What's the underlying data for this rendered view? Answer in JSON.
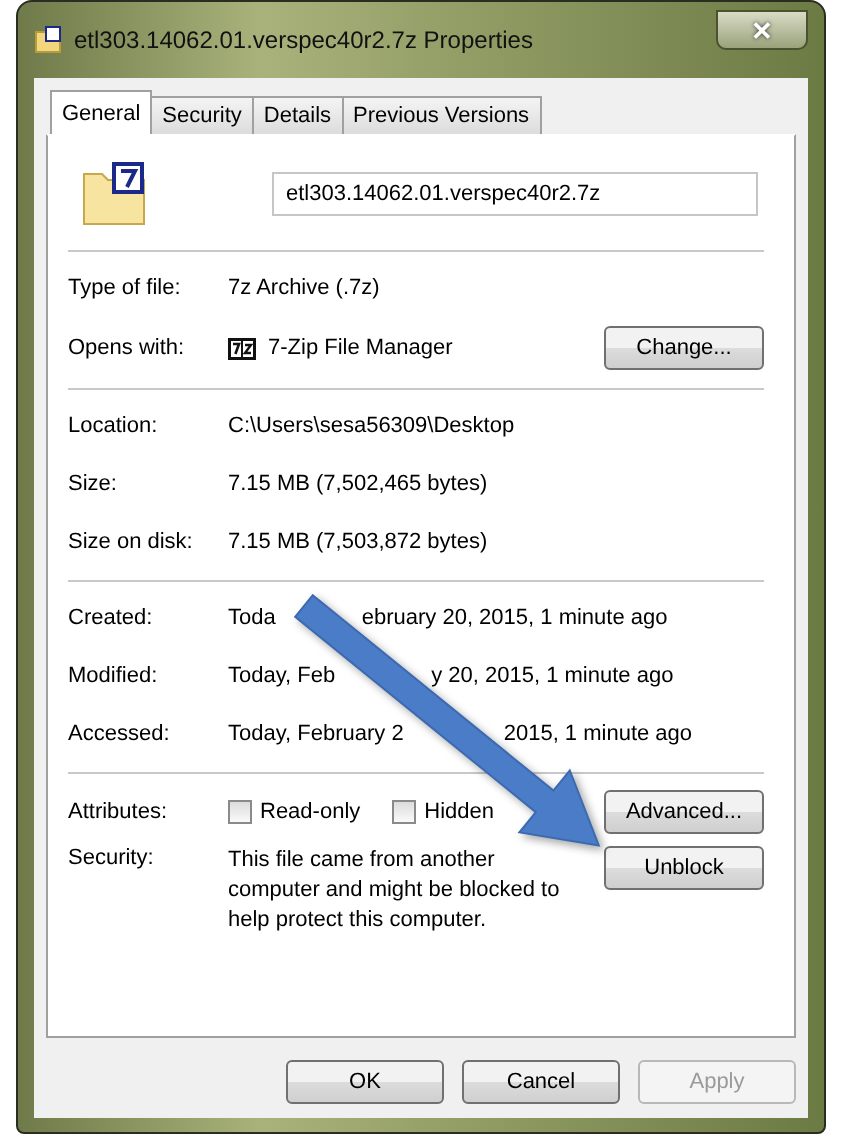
{
  "window": {
    "title": "etl303.14062.01.verspec40r2.7z Properties",
    "close": "✕"
  },
  "tabs": [
    {
      "label": "General",
      "selected": true
    },
    {
      "label": "Security",
      "selected": false
    },
    {
      "label": "Details",
      "selected": false
    },
    {
      "label": "Previous Versions",
      "selected": false
    }
  ],
  "file_name": {
    "value": "etl303.14062.01.verspec40r2.7z"
  },
  "sections": [
    [
      {
        "kind": "text",
        "label": "Type of file:",
        "value": "7z Archive (.7z)"
      },
      {
        "kind": "app",
        "label": "Opens with:",
        "value": "7-Zip File Manager",
        "button": "Change..."
      }
    ],
    [
      {
        "kind": "text",
        "label": "Location:",
        "value": "C:\\Users\\sesa56309\\Desktop"
      },
      {
        "kind": "text",
        "label": "Size:",
        "value": "7.15 MB (7,502,465 bytes)"
      },
      {
        "kind": "text",
        "label": "Size on disk:",
        "value": "7.15 MB (7,503,872 bytes)"
      }
    ],
    [
      {
        "kind": "partial",
        "label": "Created:",
        "fragments": [
          "Toda",
          "ebruary 20, 2015, 1 minute ago"
        ]
      },
      {
        "kind": "partial",
        "label": "Modified:",
        "fragments": [
          "Today, Feb",
          "y 20, 2015, 1 minute ago"
        ]
      },
      {
        "kind": "partial",
        "label": "Accessed:",
        "fragments": [
          "Today, February 2",
          "2015, 1 minute ago"
        ]
      }
    ]
  ],
  "attributes": {
    "label": "Attributes:",
    "checkboxes": [
      {
        "label": "Read-only",
        "checked": false
      },
      {
        "label": "Hidden",
        "checked": false
      }
    ],
    "button": "Advanced..."
  },
  "security": {
    "label": "Security:",
    "text": "This file came from another computer and might be blocked to help protect this computer.",
    "button": "Unblock"
  },
  "buttons": [
    {
      "label": "OK",
      "disabled": false
    },
    {
      "label": "Cancel",
      "disabled": false
    },
    {
      "label": "Apply",
      "disabled": true
    }
  ]
}
